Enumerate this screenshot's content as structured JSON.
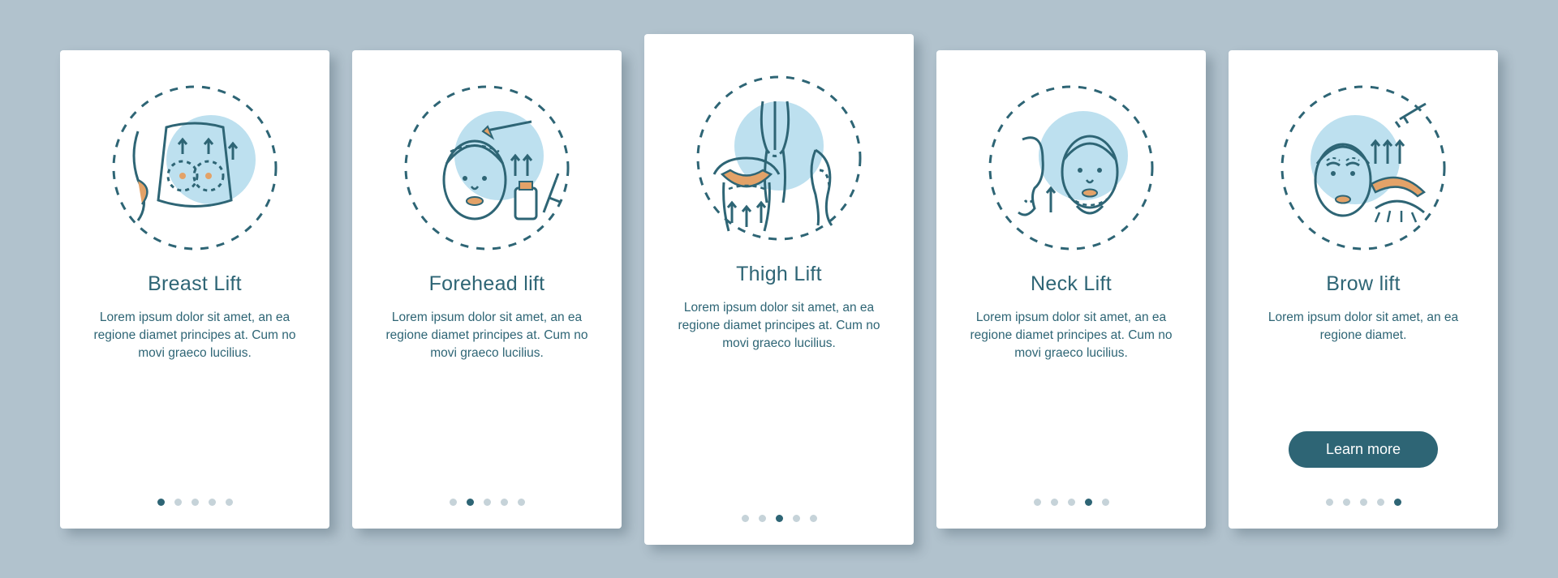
{
  "colors": {
    "accent": "#2e6575",
    "orange": "#e3a268",
    "blue": "#bde0ef",
    "bg": "#b1c2cd"
  },
  "cards": [
    {
      "title": "Breast Lift",
      "desc": "Lorem ipsum dolor sit amet, an ea regione diamet principes at. Cum no movi graeco lucilius.",
      "active": 0,
      "featured": false
    },
    {
      "title": "Forehead lift",
      "desc": "Lorem ipsum dolor sit amet, an ea regione diamet principes at. Cum no movi graeco lucilius.",
      "active": 1,
      "featured": false
    },
    {
      "title": "Thigh Lift",
      "desc": "Lorem ipsum dolor sit amet, an ea regione diamet principes at. Cum no movi graeco lucilius.",
      "active": 2,
      "featured": true
    },
    {
      "title": "Neck Lift",
      "desc": "Lorem ipsum dolor sit amet, an ea regione diamet principes at. Cum no movi graeco lucilius.",
      "active": 3,
      "featured": false
    },
    {
      "title": "Brow lift",
      "desc": "Lorem ipsum dolor sit amet, an ea regione diamet.",
      "active": 4,
      "featured": false,
      "cta": "Learn more"
    }
  ],
  "dot_count": 5
}
